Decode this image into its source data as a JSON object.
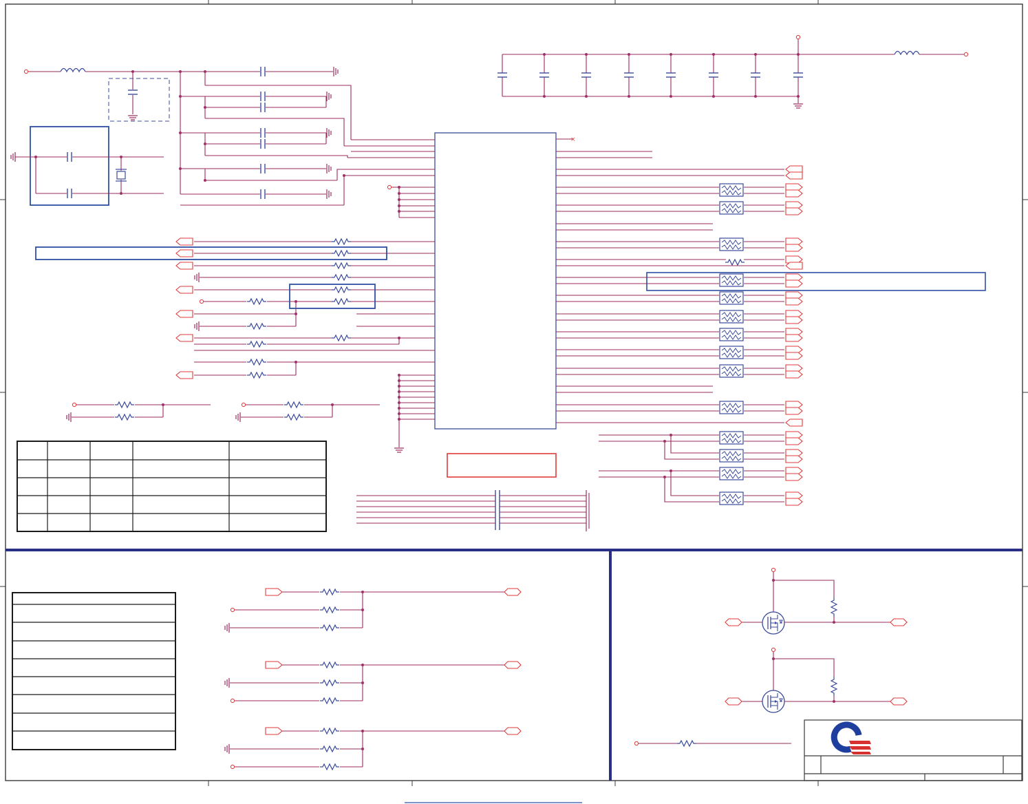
{
  "colors": {
    "wire": "#9b2a5c",
    "signal_outline": "#e23a3a",
    "component": "#3a4a9c",
    "highlight_box": "#2e4fa3",
    "note_box": "#e23a3a",
    "frame": "#3a3a3a",
    "bus": "#2a2f86",
    "logo_blue": "#1f3f9e",
    "logo_red": "#d63030",
    "junction": "#a0306a"
  }
}
